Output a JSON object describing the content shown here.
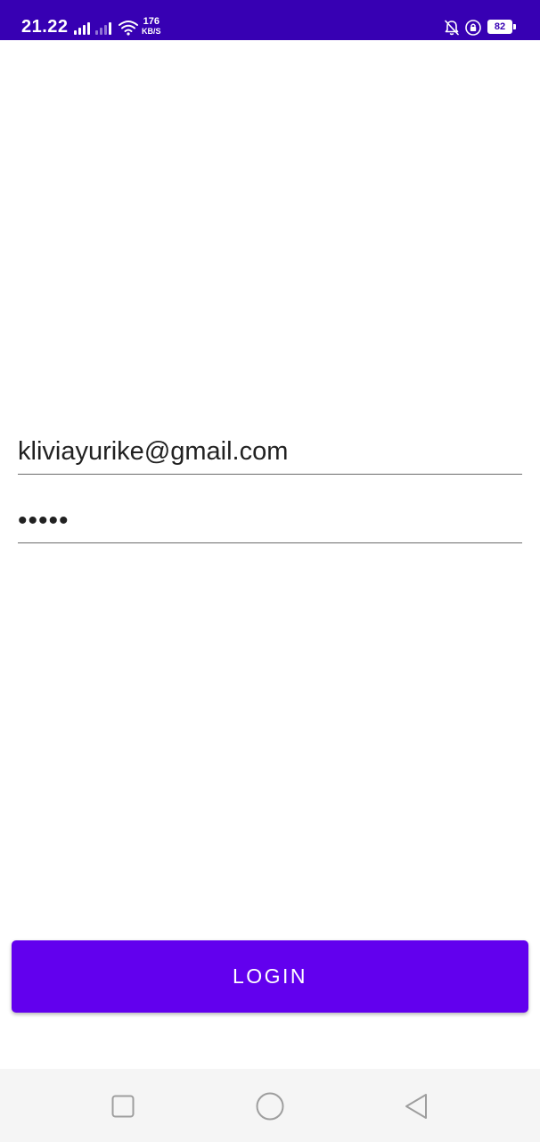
{
  "status_bar": {
    "time": "21.22",
    "net_speed_value": "176",
    "net_speed_unit": "KB/S",
    "battery_level": "82",
    "icons": [
      "signal-1-icon",
      "signal-2-icon",
      "wifi-icon",
      "bell-muted-icon",
      "lock-rotation-icon",
      "battery-icon"
    ],
    "background_color": "#3700b3"
  },
  "login_form": {
    "email": {
      "value": "kliviayurike@gmail.com",
      "placeholder": ""
    },
    "password": {
      "value": "•••••",
      "placeholder": ""
    },
    "login_button_label": "LOGIN",
    "accent_color": "#6200ee"
  },
  "nav_bar": {
    "icons": [
      "recent-apps-icon",
      "home-icon",
      "back-icon"
    ]
  }
}
